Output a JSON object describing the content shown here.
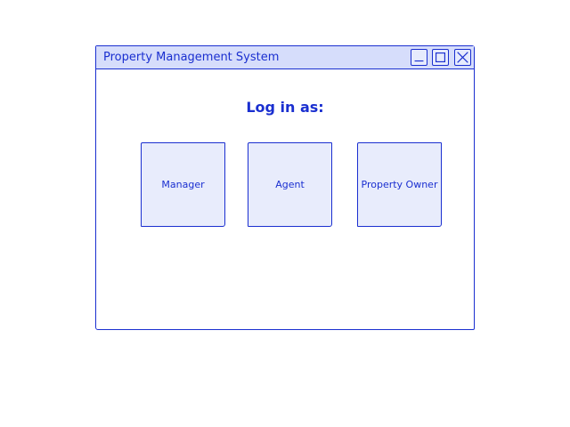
{
  "window": {
    "title": "Property Management System",
    "controls": {
      "minimize_icon": "minimize-icon",
      "maximize_icon": "maximize-icon",
      "close_icon": "close-icon"
    }
  },
  "main": {
    "heading": "Log in as:",
    "roles": [
      {
        "label": "Manager"
      },
      {
        "label": "Agent"
      },
      {
        "label": "Property Owner"
      }
    ]
  },
  "colors": {
    "accent": "#1a2fd0",
    "titlebar_bg": "#d6ddfb",
    "tile_bg": "#e8ecfc"
  }
}
